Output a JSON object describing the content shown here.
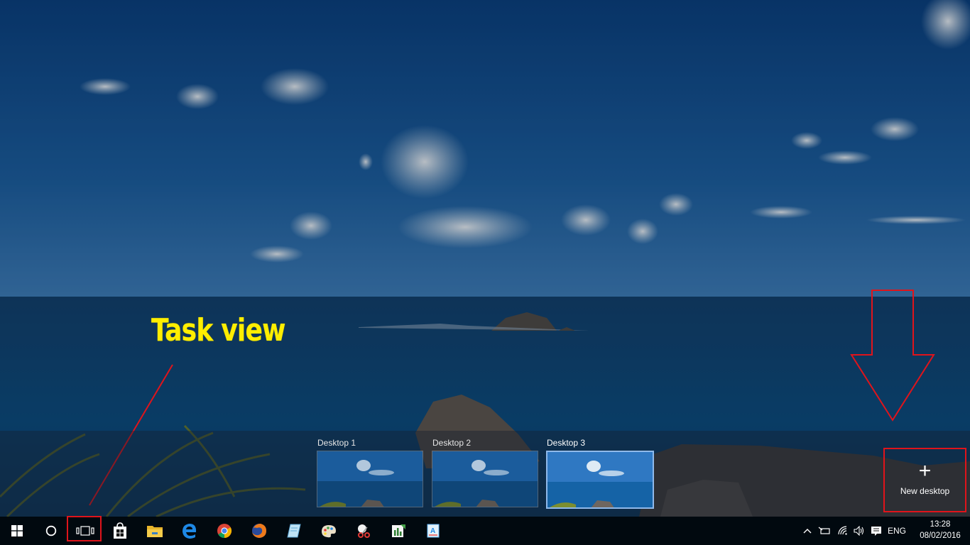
{
  "annotation": {
    "task_view_label": "Task view"
  },
  "desktops": [
    {
      "label": "Desktop 1",
      "active": false
    },
    {
      "label": "Desktop 2",
      "active": false
    },
    {
      "label": "Desktop 3",
      "active": true
    }
  ],
  "new_desktop": {
    "plus": "+",
    "label": "New desktop"
  },
  "taskbar": {
    "pinned_icons": [
      "start-icon",
      "cortana-icon",
      "task-view-icon",
      "store-icon",
      "file-explorer-icon",
      "edge-icon",
      "chrome-icon",
      "firefox-icon",
      "notepad-icon",
      "paint-icon",
      "snipping-tool-icon",
      "sway-icon",
      "wordpad-icon"
    ],
    "tray": {
      "language": "ENG",
      "time": "13:28",
      "date": "08/02/2016"
    }
  },
  "colors": {
    "annotation_red": "#e0141b",
    "annotation_yellow": "#ffee00",
    "active_desktop_border": "#8fb9ea"
  }
}
